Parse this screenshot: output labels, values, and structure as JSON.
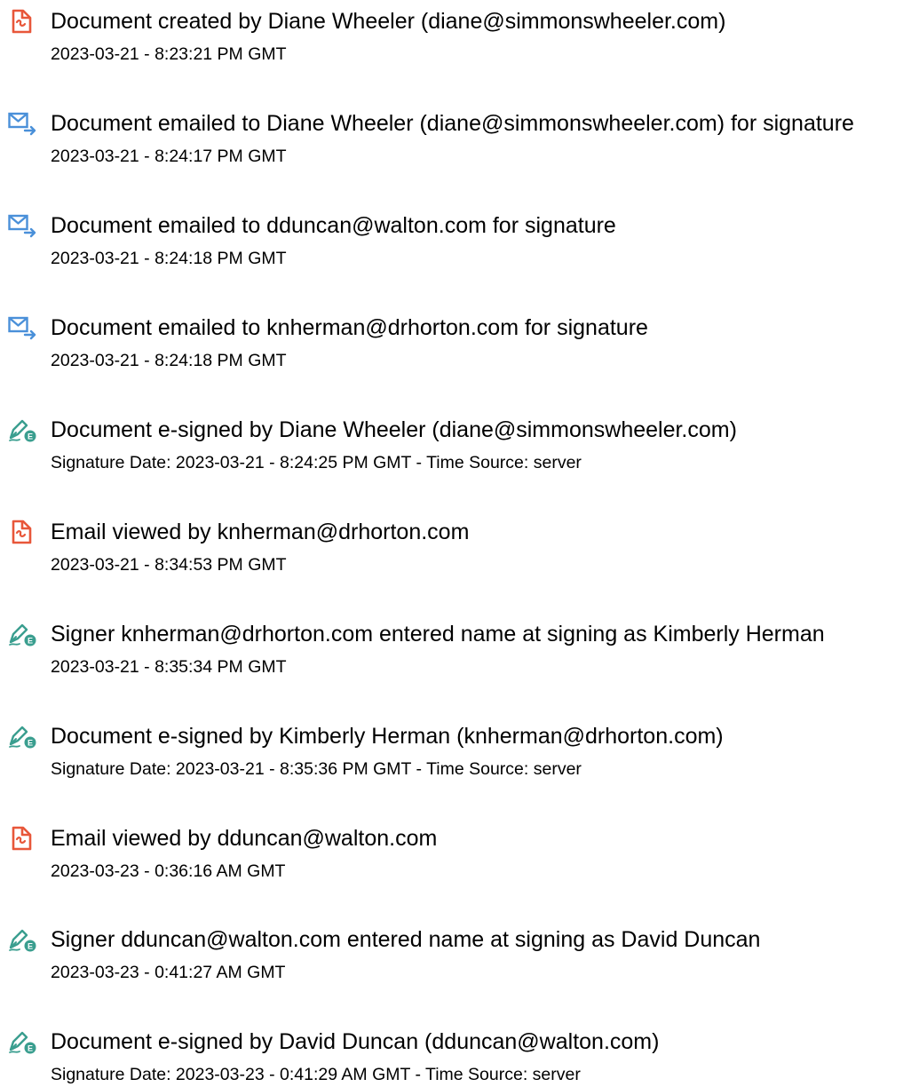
{
  "entries": [
    {
      "icon": "document-created-icon",
      "text": "Document created by Diane Wheeler (diane@simmonswheeler.com)",
      "detail": "2023-03-21 - 8:23:21 PM GMT"
    },
    {
      "icon": "email-sent-icon",
      "text": "Document emailed to Diane Wheeler (diane@simmonswheeler.com) for signature",
      "detail": "2023-03-21 - 8:24:17 PM GMT"
    },
    {
      "icon": "email-sent-icon",
      "text": "Document emailed to dduncan@walton.com for signature",
      "detail": "2023-03-21 - 8:24:18 PM GMT"
    },
    {
      "icon": "email-sent-icon",
      "text": "Document emailed to knherman@drhorton.com for signature",
      "detail": "2023-03-21 - 8:24:18 PM GMT"
    },
    {
      "icon": "e-sign-pen-icon",
      "text": "Document e-signed by Diane Wheeler (diane@simmonswheeler.com)",
      "detail": "Signature Date: 2023-03-21 - 8:24:25 PM GMT - Time Source: server"
    },
    {
      "icon": "document-viewed-icon",
      "text": "Email viewed by knherman@drhorton.com",
      "detail": "2023-03-21 - 8:34:53 PM GMT"
    },
    {
      "icon": "e-sign-pen-icon",
      "text": "Signer knherman@drhorton.com entered name at signing as Kimberly Herman",
      "detail": "2023-03-21 - 8:35:34 PM GMT"
    },
    {
      "icon": "e-sign-pen-icon",
      "text": "Document e-signed by Kimberly Herman (knherman@drhorton.com)",
      "detail": "Signature Date: 2023-03-21 - 8:35:36 PM GMT - Time Source: server"
    },
    {
      "icon": "document-viewed-icon",
      "text": "Email viewed by dduncan@walton.com",
      "detail": "2023-03-23 - 0:36:16 AM GMT"
    },
    {
      "icon": "e-sign-pen-icon",
      "text": "Signer dduncan@walton.com entered name at signing as David Duncan",
      "detail": "2023-03-23 - 0:41:27 AM GMT"
    },
    {
      "icon": "e-sign-pen-icon",
      "text": "Document e-signed by David Duncan (dduncan@walton.com)",
      "detail": "Signature Date: 2023-03-23 - 0:41:29 AM GMT - Time Source: server"
    }
  ],
  "colors": {
    "document_icon": "#e8573a",
    "email_icon": "#4a90d9",
    "pen_icon": "#3a9e8f",
    "text": "#000000"
  }
}
